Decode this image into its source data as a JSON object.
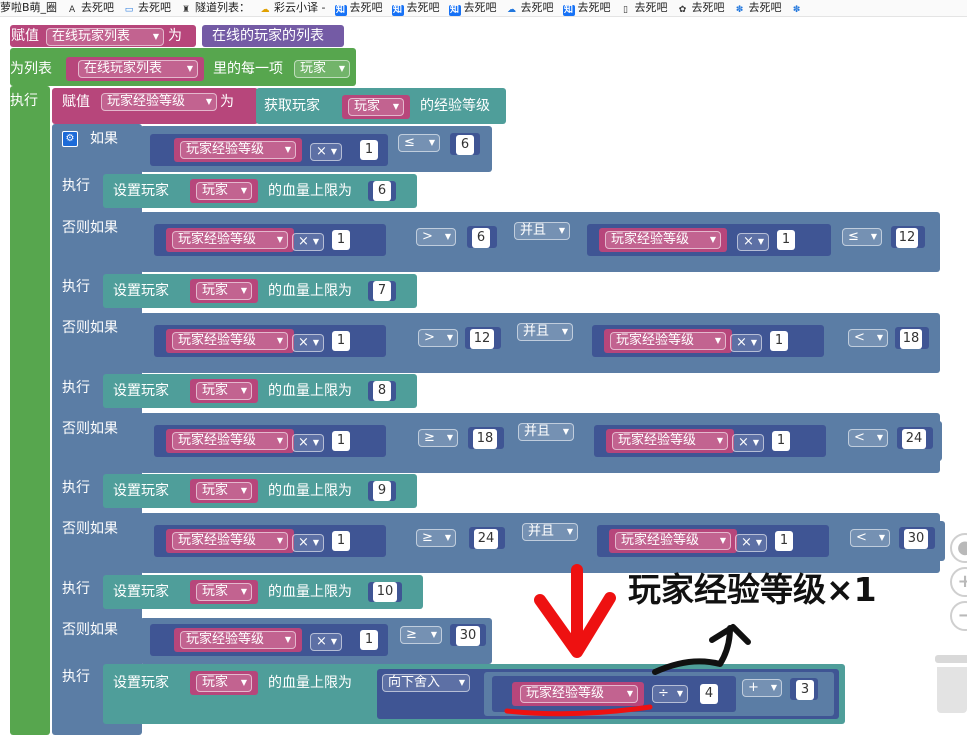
{
  "bookmarks": [
    {
      "icon": "",
      "label": "萝啦B萌_圈"
    },
    {
      "icon": "A",
      "label": "去死吧",
      "style": "plain"
    },
    {
      "icon": "▭",
      "label": "去死吧",
      "style": "blue"
    },
    {
      "icon": "♜",
      "label": "隧道列表：",
      "style": "plain"
    },
    {
      "icon": "☁",
      "label": "彩云小译 -",
      "style": "gold"
    },
    {
      "icon": "知",
      "label": "去死吧",
      "style": "zhi"
    },
    {
      "icon": "知",
      "label": "去死吧",
      "style": "zhi"
    },
    {
      "icon": "知",
      "label": "去死吧",
      "style": "zhi"
    },
    {
      "icon": "☁",
      "label": "去死吧",
      "style": "blue"
    },
    {
      "icon": "知",
      "label": "去死吧",
      "style": "zhi"
    },
    {
      "icon": "▯",
      "label": "去死吧",
      "style": "plain"
    },
    {
      "icon": "✿",
      "label": "去死吧",
      "style": "plain"
    },
    {
      "icon": "✽",
      "label": "去死吧",
      "style": "blue"
    },
    {
      "icon": "✽",
      "label": "",
      "style": "blue"
    }
  ],
  "kw": {
    "assign": "赋值",
    "to": "为",
    "for_list": "为列表",
    "each_item": "里的每一项",
    "do": "执行",
    "if": "如果",
    "else_if": "否则如果",
    "set_player": "设置玩家",
    "max_hp_to": "的血量上限为",
    "get_player": "获取玩家",
    "exp_level_of": "的经验等级",
    "online_players": "在线的玩家的列表",
    "and": "并且",
    "floor": "向下舍入"
  },
  "vars": {
    "online_list": "在线玩家列表",
    "player": "玩家",
    "exp_level": "玩家经验等级"
  },
  "ops": {
    "mul": "×",
    "le": "≤",
    "gt": ">",
    "ge": "≥",
    "lt": "<",
    "div": "÷",
    "plus": "+"
  },
  "numbers": {
    "one": "1",
    "if1": "6",
    "hp1": "6",
    "eif1_a": "6",
    "eif1_b": "12",
    "hp2": "7",
    "eif2_a": "12",
    "eif2_b": "18",
    "hp3": "8",
    "eif3_a": "18",
    "eif3_b": "24",
    "hp4": "9",
    "eif4_a": "24",
    "eif4_b": "30",
    "hp5": "10",
    "eif5": "30",
    "divisor": "4",
    "addend": "3"
  },
  "annotation": {
    "text": "玩家经验等级×1",
    "color": "#111111",
    "arrow_color": "#ee1111"
  },
  "colors": {
    "loop": "#57a64e",
    "variable": "#b7467b",
    "text": "#745ba5",
    "action": "#4f9e9a",
    "logic": "#5b7da5",
    "math": "#3f5594"
  }
}
